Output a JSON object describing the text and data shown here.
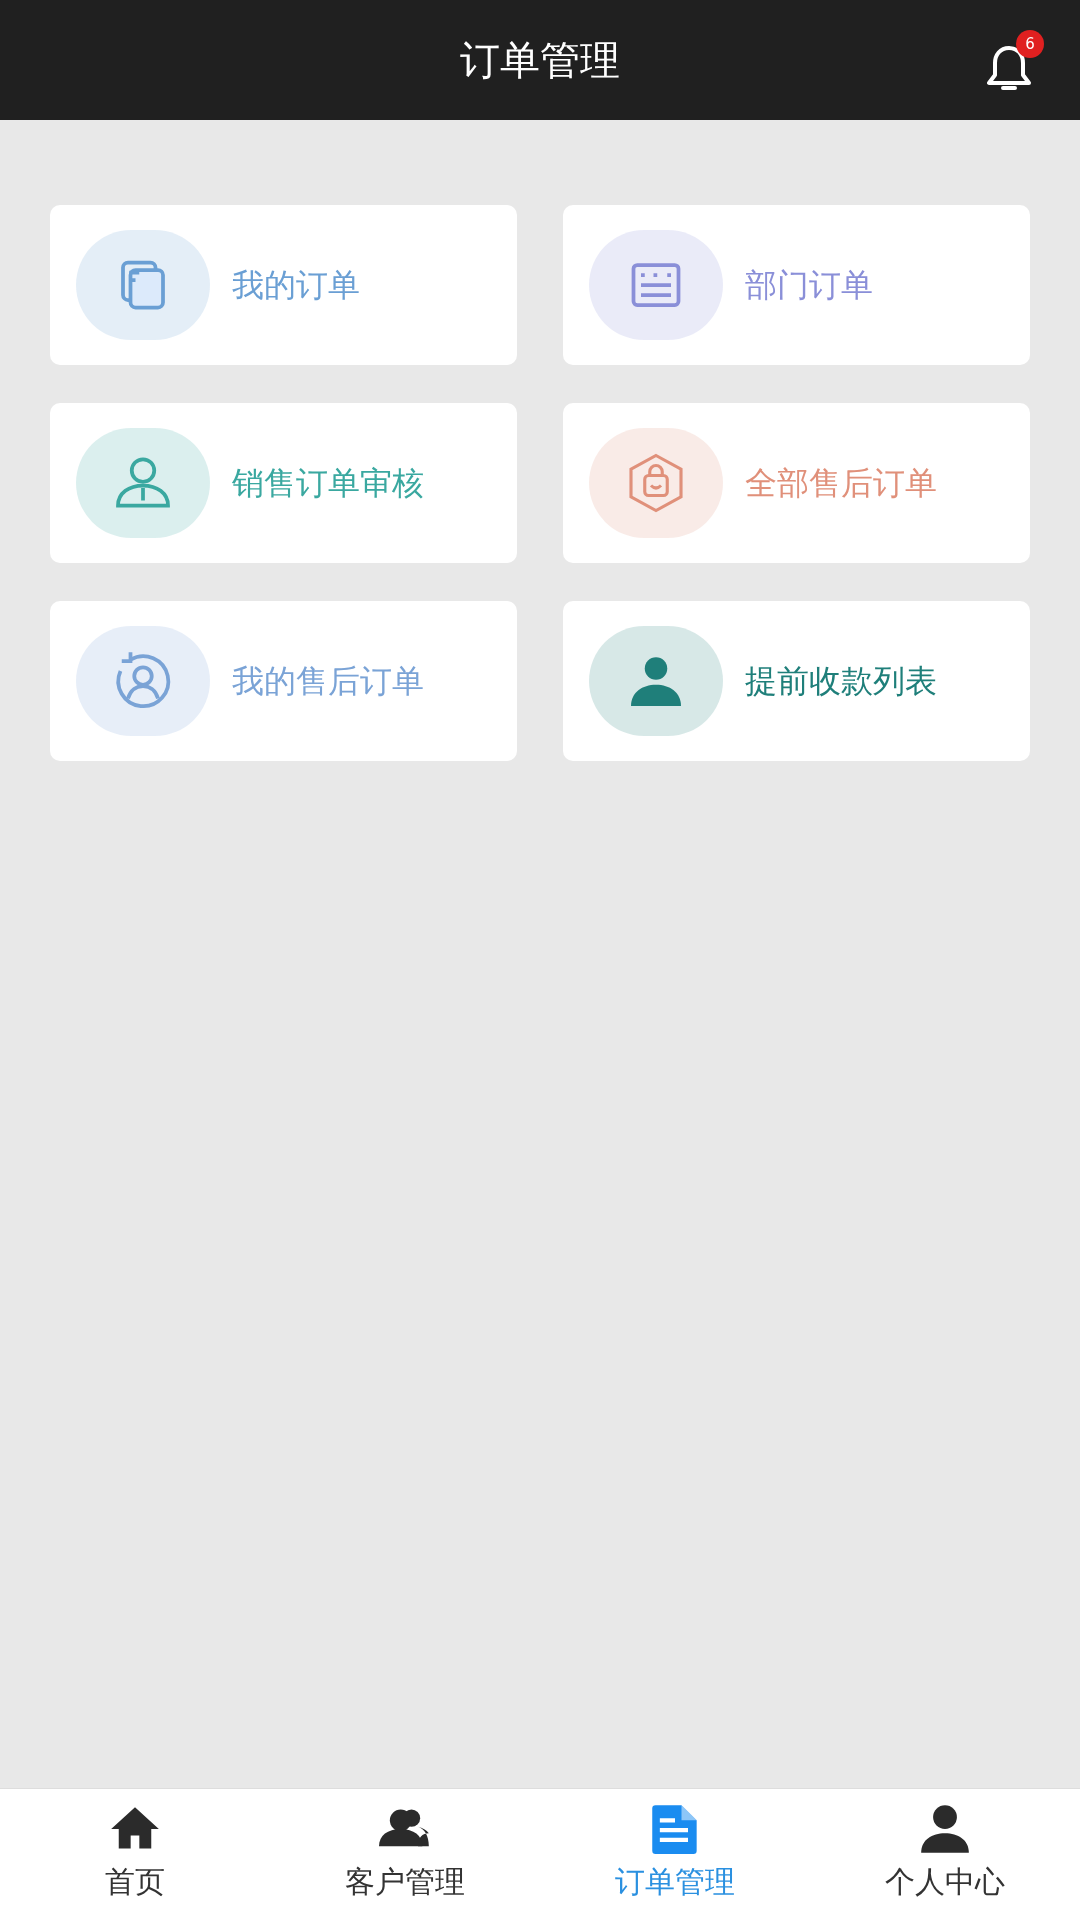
{
  "header": {
    "title": "订单管理",
    "notification_count": "6"
  },
  "menu": [
    {
      "label": "我的订单",
      "kind": "documents",
      "color": "#6a9fd4"
    },
    {
      "label": "部门订单",
      "kind": "form",
      "color": "#8a8fd8"
    },
    {
      "label": "销售订单审核",
      "kind": "reviewer",
      "color": "#3aa8a0"
    },
    {
      "label": "全部售后订单",
      "kind": "bag",
      "color": "#e0907a"
    },
    {
      "label": "我的售后订单",
      "kind": "user-cycle",
      "color": "#7aa3d6"
    },
    {
      "label": "提前收款列表",
      "kind": "agent",
      "color": "#1f7f7a"
    }
  ],
  "tab_bar": [
    {
      "label": "首页",
      "kind": "home",
      "selected": false
    },
    {
      "label": "客户管理",
      "kind": "users",
      "selected": false
    },
    {
      "label": "订单管理",
      "kind": "doc",
      "selected": true
    },
    {
      "label": "个人中心",
      "kind": "user",
      "selected": false
    }
  ]
}
